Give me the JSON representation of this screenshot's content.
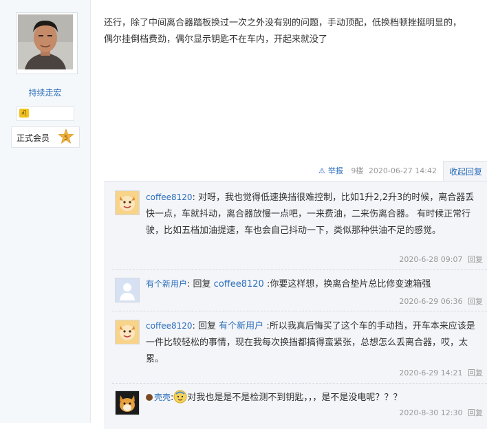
{
  "author": {
    "name": "持续走宏",
    "zodiac_icon": "leo-icon",
    "member_label": "正式会员",
    "level": "5"
  },
  "post": {
    "content": "还行，除了中间离合器踏板换过一次之外没有别的问题，手动顶配，低换档顿挫挺明显的，\n偶尔挂倒档费劲，偶尔显示钥匙不在车内，开起来就没了",
    "report_label": "举报",
    "floor": "9楼",
    "timestamp": "2020-06-27 14:42",
    "collapse_label": "收起回复"
  },
  "replies": [
    {
      "user": "coffee8120",
      "colon": ":",
      "target_prefix": "",
      "target": "",
      "content": " 对呀，我也觉得低速换挡很难控制，比如1升2,2升3的时候，离合器丢快一点，车就抖动，离合器放慢一点吧，一来费油，二来伤离合器。 有时候正常行驶，比如五档加油提速，车也会自己抖动一下，类似那种供油不足的感觉。",
      "time": "2020-6-28 09:07",
      "reply_label": "回复"
    },
    {
      "user": "有个新用户",
      "colon": ":",
      "target_prefix": " 回复 ",
      "target": "coffee8120",
      "content": " :你要这样想，换离合垫片总比修变速箱强",
      "time": "2020-6-29 06:36",
      "reply_label": "回复"
    },
    {
      "user": "coffee8120",
      "colon": ":",
      "target_prefix": " 回复 ",
      "target": "有个新用户",
      "content": " :所以我真后悔买了这个车的手动挡，开车本来应该是一件比较轻松的事情，现在我每次换挡都搞得蛮紧张，总想怎么丢离合器，哎，太累。",
      "time": "2020-6-29 14:21",
      "reply_label": "回复"
    },
    {
      "user": "壳壳",
      "colon": ":",
      "target_prefix": "",
      "target": "",
      "content": "对我也是是不是检测不到钥匙，，，是不是没电呢？？？",
      "time": "2020-8-30 12:30",
      "reply_label": "回复"
    }
  ]
}
